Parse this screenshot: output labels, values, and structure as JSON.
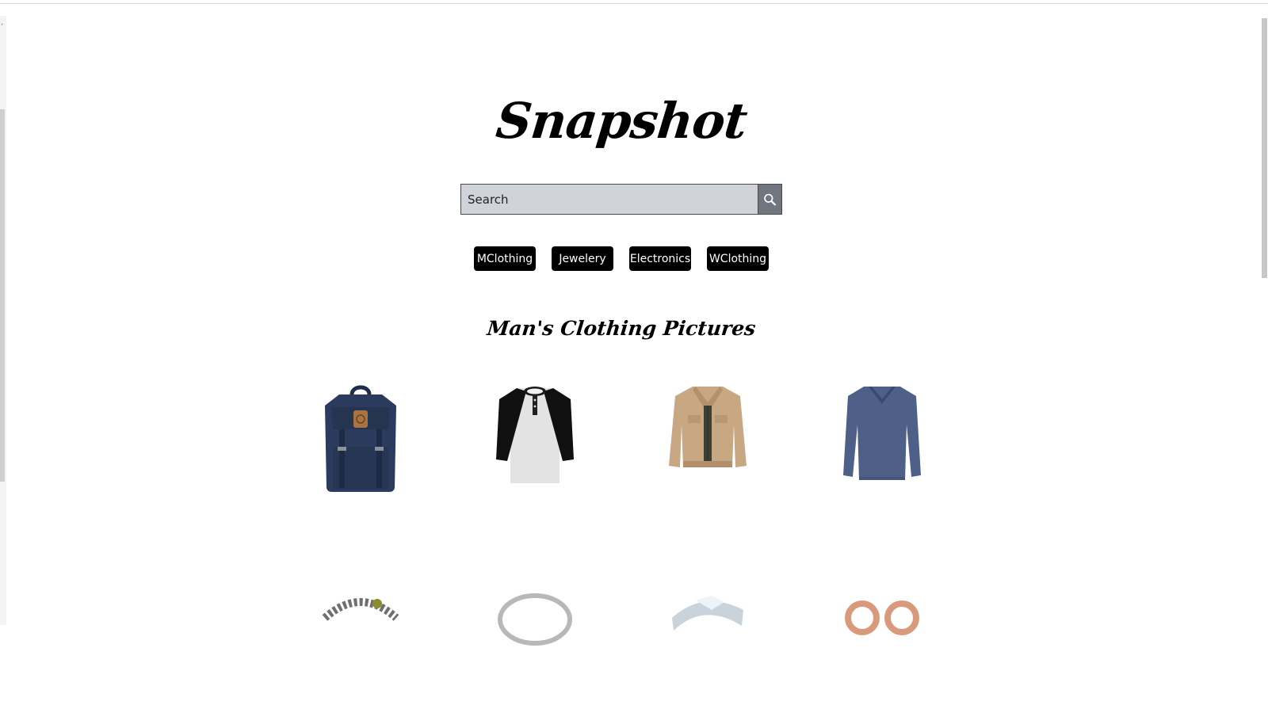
{
  "app": {
    "logo_text": "Snapshot"
  },
  "search": {
    "placeholder": "Search",
    "value": "",
    "button_icon": "search-icon"
  },
  "categories": [
    {
      "label": "MClothing"
    },
    {
      "label": "Jewelery"
    },
    {
      "label": "Electronics"
    },
    {
      "label": "WClothing"
    }
  ],
  "section": {
    "title": "Man's Clothing Pictures"
  },
  "products": [
    {
      "icon": "backpack-image"
    },
    {
      "icon": "raglan-henley-shirt-image"
    },
    {
      "icon": "tan-jacket-image"
    },
    {
      "icon": "blue-long-sleeve-shirt-image"
    },
    {
      "icon": "dragon-bracelet-image"
    },
    {
      "icon": "silver-ring-image"
    },
    {
      "icon": "diamond-ring-image"
    },
    {
      "icon": "rose-gold-earrings-image"
    }
  ],
  "colors": {
    "search_bg": "#d1d3db",
    "search_button": "#71757f",
    "category_button": "#000000",
    "page_bg": "#ffffff"
  }
}
